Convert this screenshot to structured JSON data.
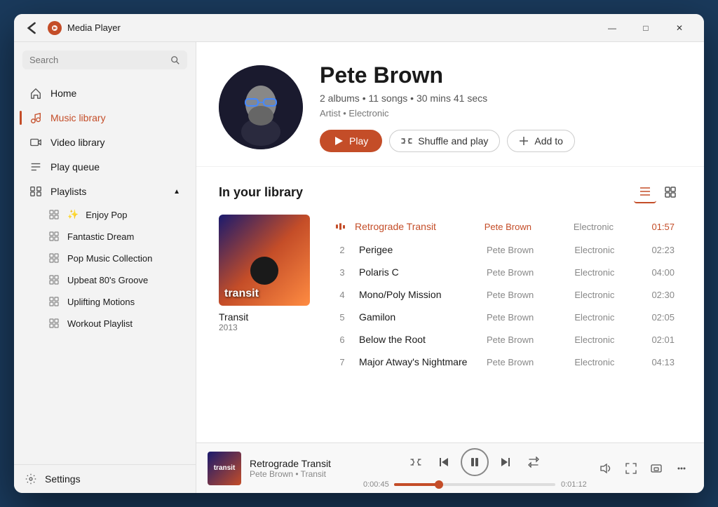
{
  "window": {
    "title": "Media Player",
    "back_label": "←",
    "min_label": "—",
    "max_label": "□",
    "close_label": "✕"
  },
  "sidebar": {
    "search_placeholder": "Search",
    "nav": [
      {
        "id": "home",
        "label": "Home",
        "icon": "home-icon"
      },
      {
        "id": "music-library",
        "label": "Music library",
        "icon": "music-icon",
        "active": true
      },
      {
        "id": "video-library",
        "label": "Video library",
        "icon": "video-icon"
      },
      {
        "id": "play-queue",
        "label": "Play queue",
        "icon": "queue-icon"
      }
    ],
    "playlists_label": "Playlists",
    "playlists": [
      {
        "id": "enjoy-pop",
        "label": "Enjoy Pop",
        "special": true
      },
      {
        "id": "fantastic-dream",
        "label": "Fantastic Dream"
      },
      {
        "id": "pop-music-collection",
        "label": "Pop Music Collection"
      },
      {
        "id": "upbeat-groove",
        "label": "Upbeat 80's Groove"
      },
      {
        "id": "uplifting-motions",
        "label": "Uplifting Motions"
      },
      {
        "id": "workout-playlist",
        "label": "Workout Playlist"
      }
    ],
    "settings_label": "Settings"
  },
  "artist": {
    "name": "Pete Brown",
    "stats": "2 albums • 11 songs • 30 mins 41 secs",
    "tags": "Artist • Electronic",
    "play_label": "Play",
    "shuffle_label": "Shuffle and play",
    "add_label": "Add to"
  },
  "library": {
    "title": "In your library",
    "album": {
      "name": "Transit",
      "year": "2013",
      "label": "transit"
    },
    "tracks": [
      {
        "num": "1",
        "name": "Retrograde Transit",
        "artist": "Pete Brown",
        "genre": "Electronic",
        "duration": "01:57",
        "playing": true
      },
      {
        "num": "2",
        "name": "Perigee",
        "artist": "Pete Brown",
        "genre": "Electronic",
        "duration": "02:23",
        "playing": false
      },
      {
        "num": "3",
        "name": "Polaris C",
        "artist": "Pete Brown",
        "genre": "Electronic",
        "duration": "04:00",
        "playing": false
      },
      {
        "num": "4",
        "name": "Mono/Poly Mission",
        "artist": "Pete Brown",
        "genre": "Electronic",
        "duration": "02:30",
        "playing": false
      },
      {
        "num": "5",
        "name": "Gamilon",
        "artist": "Pete Brown",
        "genre": "Electronic",
        "duration": "02:05",
        "playing": false
      },
      {
        "num": "6",
        "name": "Below the Root",
        "artist": "Pete Brown",
        "genre": "Electronic",
        "duration": "02:01",
        "playing": false
      },
      {
        "num": "7",
        "name": "Major Atway's Nightmare",
        "artist": "Pete Brown",
        "genre": "Electronic",
        "duration": "04:13",
        "playing": false
      }
    ]
  },
  "player": {
    "track_name": "Retrograde Transit",
    "track_meta": "Pete Brown • Transit",
    "time_current": "0:00:45",
    "time_remaining": "0:01:12",
    "progress_percent": 28
  }
}
